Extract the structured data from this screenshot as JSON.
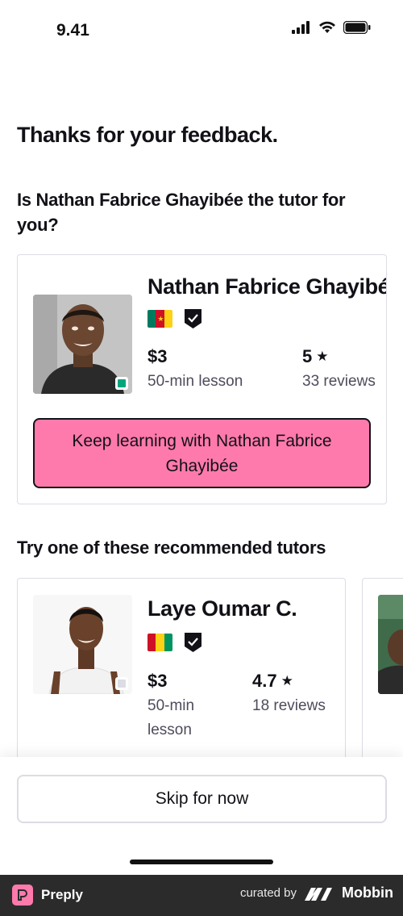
{
  "status_bar": {
    "time": "9.41",
    "icons": [
      "signal-icon",
      "wifi-icon",
      "battery-icon"
    ]
  },
  "headline": "Thanks for your feedback.",
  "question": "Is Nathan Fabrice Ghayibée the tutor for you?",
  "current_tutor": {
    "name": "Nathan Fabrice Ghayibée",
    "flag": "cameroon-flag-icon",
    "price": "$3",
    "price_sub": "50-min lesson",
    "rating": "5",
    "reviews": "33 reviews",
    "online": true,
    "cta": "Keep learning with Nathan Fabrice Ghayibée"
  },
  "recommended": {
    "title": "Try one of these recommended tutors",
    "tutors": [
      {
        "name": "Laye Oumar C.",
        "flag": "guinea-flag-icon",
        "price": "$3",
        "price_sub": "50-min lesson",
        "rating": "4.7",
        "reviews": "18 reviews",
        "online": false
      }
    ]
  },
  "skip_button": "Skip for now",
  "footer": {
    "brand": "Preply",
    "curated_by": "curated by",
    "curator": "Mobbin"
  },
  "colors": {
    "accent": "#ff7aac",
    "online": "#00a67e",
    "text": "#121117",
    "border": "#dcdce5"
  }
}
